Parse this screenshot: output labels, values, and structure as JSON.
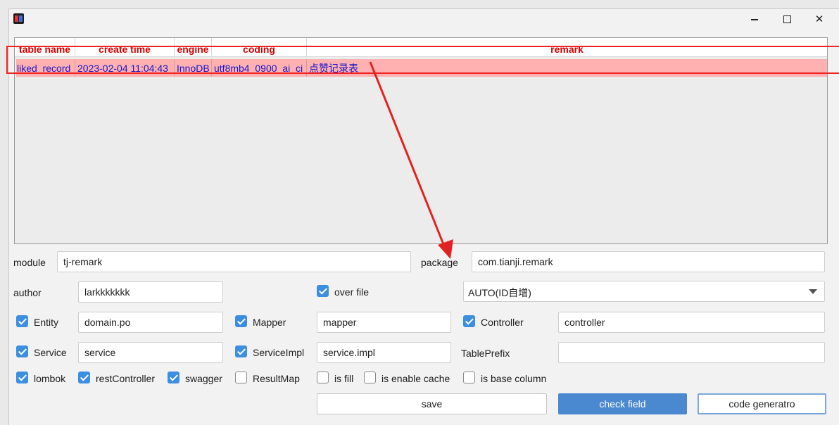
{
  "table": {
    "headers": [
      "table name",
      "create time",
      "engine",
      "coding",
      "remark"
    ],
    "rows": [
      [
        "liked_record",
        "2023-02-04 11:04:43",
        "InnoDB",
        "utf8mb4_0900_ai_ci",
        "点赞记录表"
      ]
    ]
  },
  "form": {
    "module_label": "module",
    "module_value": "tj-remark",
    "package_label": "package",
    "package_value": "com.tianji.remark",
    "author_label": "author",
    "author_value": "larkkkkkkk",
    "over_file_label": "over file",
    "id_type_value": "AUTO(ID自增)",
    "entity_label": "Entity",
    "entity_value": "domain.po",
    "mapper_label": "Mapper",
    "mapper_value": "mapper",
    "controller_label": "Controller",
    "controller_value": "controller",
    "service_label": "Service",
    "service_value": "service",
    "serviceimpl_label": "ServiceImpl",
    "serviceimpl_value": "service.impl",
    "tableprefix_label": "TablePrefix",
    "tableprefix_value": "",
    "lombok_label": "lombok",
    "restcontroller_label": "restController",
    "swagger_label": "swagger",
    "resultmap_label": "ResultMap",
    "isfill_label": "is fill",
    "cache_label": "is enable cache",
    "basecolumn_label": "is base column"
  },
  "checkboxes": {
    "over_file": true,
    "entity": true,
    "mapper": true,
    "controller": true,
    "service": true,
    "serviceimpl": true,
    "lombok": true,
    "restcontroller": true,
    "swagger": true,
    "resultmap": false,
    "isfill": false,
    "cache": false,
    "basecolumn": false
  },
  "buttons": {
    "save": "save",
    "check_field": "check field",
    "code_generatro": "code generatro"
  },
  "colors": {
    "accent": "#4a88cf",
    "header_text": "#d40000",
    "row_highlight": "#ffb1b1",
    "row_text": "#1515c8",
    "annotation": "#e22222"
  }
}
